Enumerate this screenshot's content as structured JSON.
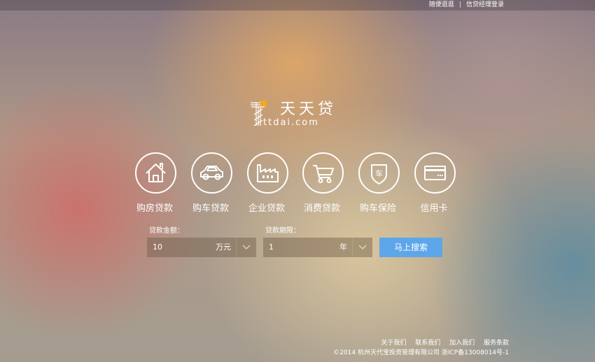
{
  "topbar": {
    "link1": "随便逛逛",
    "link2": "信贷经理登录"
  },
  "logo": {
    "name_cn": "天天贷",
    "domain": "ttdai.com"
  },
  "services": [
    {
      "label": "购房贷款",
      "icon": "house-icon"
    },
    {
      "label": "购车贷款",
      "icon": "car-icon"
    },
    {
      "label": "企业贷款",
      "icon": "factory-icon"
    },
    {
      "label": "消费贷款",
      "icon": "shopping-cart-icon"
    },
    {
      "label": "购车保险",
      "icon": "car-insurance-shield-icon",
      "icon_text": "车"
    },
    {
      "label": "信用卡",
      "icon": "credit-card-icon"
    }
  ],
  "search": {
    "amount_label": "贷款金额：",
    "amount_value": "10",
    "amount_unit": "万元",
    "term_label": "贷款期限：",
    "term_value": "1",
    "term_unit": "年",
    "button": "马上搜索"
  },
  "footer": {
    "links": [
      "关于我们",
      "联系我们",
      "加入我们",
      "服务条款"
    ],
    "copyright": "©2014 杭州天代宝投资管理有限公司 浙ICP备13008014号-1"
  },
  "colors": {
    "button": "#5ea6ea",
    "logo_accent": "#f5a623"
  }
}
